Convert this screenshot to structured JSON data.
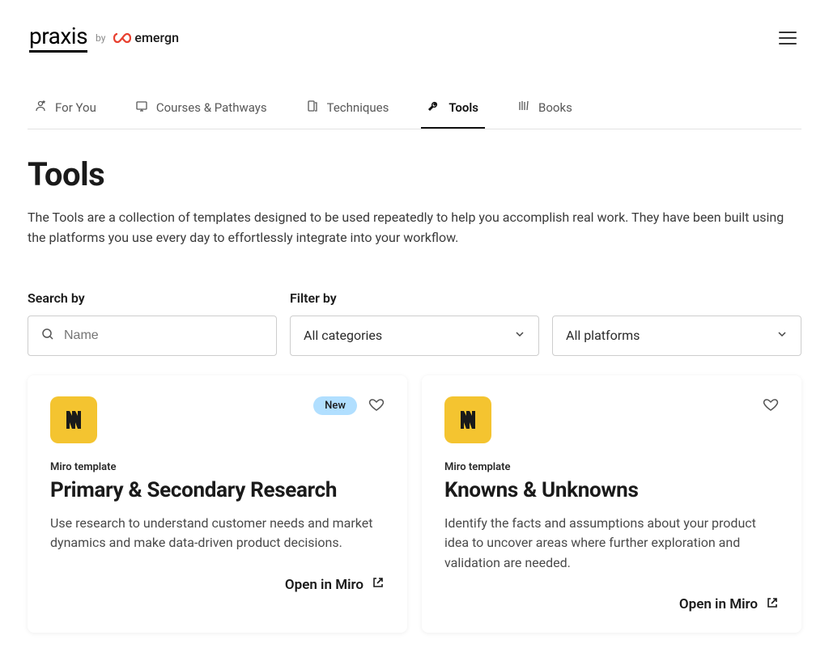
{
  "header": {
    "logo_text": "praxis",
    "logo_by": "by",
    "logo_partner": "emergn"
  },
  "tabs": [
    {
      "label": "For You",
      "icon": "user-star-icon",
      "active": false
    },
    {
      "label": "Courses & Pathways",
      "icon": "courses-icon",
      "active": false
    },
    {
      "label": "Techniques",
      "icon": "techniques-icon",
      "active": false
    },
    {
      "label": "Tools",
      "icon": "tools-icon",
      "active": true
    },
    {
      "label": "Books",
      "icon": "books-icon",
      "active": false
    }
  ],
  "page": {
    "title": "Tools",
    "description": "The Tools are a collection of templates designed to be used repeatedly to help you accomplish real work. They have been built using the platforms you use every day to effortlessly integrate into your workflow."
  },
  "controls": {
    "search_label": "Search by",
    "search_placeholder": "Name",
    "filter_label": "Filter by",
    "category_selected": "All categories",
    "platform_selected": "All platforms"
  },
  "cards": [
    {
      "subtitle": "Miro template",
      "title": "Primary & Secondary Research",
      "description": "Use research to understand customer needs and market dynamics and make data-driven product decisions.",
      "badge": "New",
      "action_label": "Open in Miro"
    },
    {
      "subtitle": "Miro template",
      "title": "Knowns & Unknowns",
      "description": "Identify the facts and assumptions about your product idea to uncover areas where further exploration and validation are needed.",
      "badge": null,
      "action_label": "Open in Miro"
    }
  ]
}
